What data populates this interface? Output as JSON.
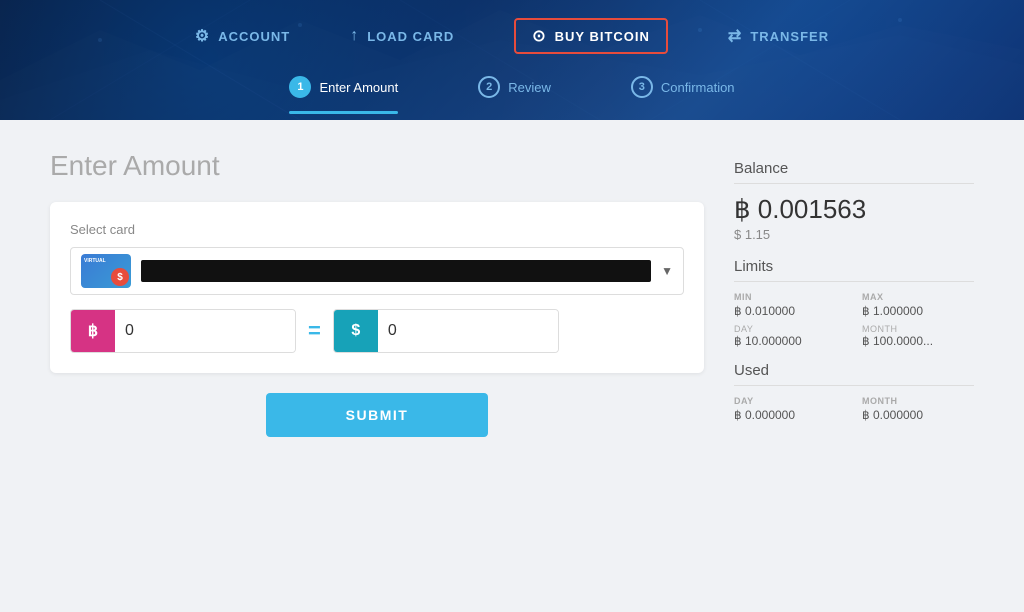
{
  "header": {
    "nav": [
      {
        "label": "ACCOUNT",
        "icon": "⚙",
        "active": false,
        "key": "account"
      },
      {
        "label": "LOAD CARD",
        "icon": "↑",
        "active": false,
        "key": "load-card"
      },
      {
        "label": "BUY BITCOIN",
        "icon": "₿",
        "active": true,
        "key": "buy-bitcoin"
      },
      {
        "label": "TRANSFER",
        "icon": "⇄",
        "active": false,
        "key": "transfer"
      }
    ],
    "steps": [
      {
        "number": "1",
        "label": "Enter Amount",
        "active": true
      },
      {
        "number": "2",
        "label": "Review",
        "active": false
      },
      {
        "number": "3",
        "label": "Confirmation",
        "active": false
      }
    ]
  },
  "page": {
    "title": "Enter Amount",
    "select_card_label": "Select card",
    "card_placeholder": "••••••••••••••••••••",
    "btc_symbol": "฿",
    "usd_symbol": "$",
    "btc_amount": "0",
    "usd_amount": "0",
    "equals": "=",
    "submit_label": "SUBMIT"
  },
  "sidebar": {
    "balance_title": "Balance",
    "balance_btc": "฿ 0.001563",
    "balance_usd": "$ 1.15",
    "limits_title": "Limits",
    "min_header": "MIN",
    "max_header": "MAX",
    "min_val": "฿ 0.010000",
    "max_val": "฿ 1.000000",
    "day_header": "DAY",
    "month_header": "MONTH",
    "day_val": "฿ 10.000000",
    "month_val": "฿ 100.0000...",
    "used_title": "Used",
    "used_day_header": "DAY",
    "used_month_header": "MONTH",
    "used_day_val": "฿ 0.000000",
    "used_month_val": "฿ 0.000000"
  }
}
